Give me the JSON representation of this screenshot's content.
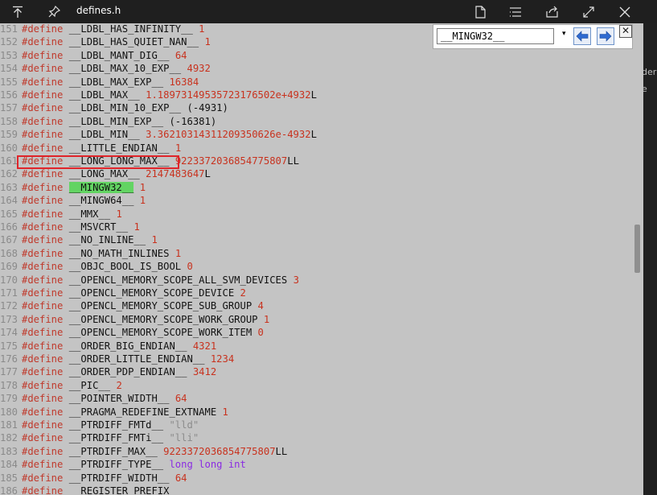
{
  "window": {
    "title": "defines.h",
    "icons": [
      "go-to-top-icon",
      "pin-icon",
      "new-file-icon",
      "list-icon",
      "share-icon",
      "expand-icon",
      "close-icon"
    ]
  },
  "find": {
    "value": "__MINGW32__",
    "dropdown": "▾",
    "prev_label": "previous",
    "next_label": "next",
    "close": "✕"
  },
  "right_strip": [
    "der",
    "e"
  ],
  "code": {
    "lines": [
      {
        "n": "151",
        "name": "__LDBL_HAS_INFINITY__",
        "value": "1"
      },
      {
        "n": "152",
        "name": "__LDBL_HAS_QUIET_NAN__",
        "value": "1"
      },
      {
        "n": "153",
        "name": "__LDBL_MANT_DIG__",
        "value": "64"
      },
      {
        "n": "154",
        "name": "__LDBL_MAX_10_EXP__",
        "value": "4932"
      },
      {
        "n": "155",
        "name": "__LDBL_MAX_EXP__",
        "value": "16384"
      },
      {
        "n": "156",
        "name": "__LDBL_MAX__",
        "value": "1.18973149535723176502e+4932",
        "suffix": "L"
      },
      {
        "n": "157",
        "name": "__LDBL_MIN_10_EXP__",
        "plain": "(-4931)"
      },
      {
        "n": "158",
        "name": "__LDBL_MIN_EXP__",
        "plain": "(-16381)"
      },
      {
        "n": "159",
        "name": "__LDBL_MIN__",
        "value": "3.36210314311209350626e-4932",
        "suffix": "L"
      },
      {
        "n": "160",
        "name": "__LITTLE_ENDIAN__",
        "value": "1"
      },
      {
        "n": "161",
        "name": "__LONG_LONG_MAX__",
        "value": "9223372036854775807",
        "suffix": "LL"
      },
      {
        "n": "162",
        "name": "__LONG_MAX__",
        "value": "2147483647",
        "suffix": "L"
      },
      {
        "n": "163",
        "name": "__MINGW32__",
        "value": "1",
        "highlight": true
      },
      {
        "n": "164",
        "name": "__MINGW64__",
        "value": "1"
      },
      {
        "n": "165",
        "name": "__MMX__",
        "value": "1"
      },
      {
        "n": "166",
        "name": "__MSVCRT__",
        "value": "1"
      },
      {
        "n": "167",
        "name": "__NO_INLINE__",
        "value": "1"
      },
      {
        "n": "168",
        "name": "__NO_MATH_INLINES",
        "value": "1"
      },
      {
        "n": "169",
        "name": "__OBJC_BOOL_IS_BOOL",
        "value": "0"
      },
      {
        "n": "170",
        "name": "__OPENCL_MEMORY_SCOPE_ALL_SVM_DEVICES",
        "value": "3"
      },
      {
        "n": "171",
        "name": "__OPENCL_MEMORY_SCOPE_DEVICE",
        "value": "2"
      },
      {
        "n": "172",
        "name": "__OPENCL_MEMORY_SCOPE_SUB_GROUP",
        "value": "4"
      },
      {
        "n": "173",
        "name": "__OPENCL_MEMORY_SCOPE_WORK_GROUP",
        "value": "1"
      },
      {
        "n": "174",
        "name": "__OPENCL_MEMORY_SCOPE_WORK_ITEM",
        "value": "0"
      },
      {
        "n": "175",
        "name": "__ORDER_BIG_ENDIAN__",
        "value": "4321"
      },
      {
        "n": "176",
        "name": "__ORDER_LITTLE_ENDIAN__",
        "value": "1234"
      },
      {
        "n": "177",
        "name": "__ORDER_PDP_ENDIAN__",
        "value": "3412"
      },
      {
        "n": "178",
        "name": "__PIC__",
        "value": "2"
      },
      {
        "n": "179",
        "name": "__POINTER_WIDTH__",
        "value": "64"
      },
      {
        "n": "180",
        "name": "__PRAGMA_REDEFINE_EXTNAME",
        "value": "1"
      },
      {
        "n": "181",
        "name": "__PTRDIFF_FMTd__",
        "str": "\"lld\""
      },
      {
        "n": "182",
        "name": "__PTRDIFF_FMTi__",
        "str": "\"lli\""
      },
      {
        "n": "183",
        "name": "__PTRDIFF_MAX__",
        "value": "9223372036854775807",
        "suffix": "LL"
      },
      {
        "n": "184",
        "name": "__PTRDIFF_TYPE__",
        "type": "long long int"
      },
      {
        "n": "185",
        "name": "__PTRDIFF_WIDTH__",
        "value": "64"
      },
      {
        "n": "186",
        "name": "__REGISTER_PREFIX__"
      }
    ],
    "keyword": "#define"
  },
  "colors": {
    "editor_bg": "#c4c4c4",
    "keyword": "#c0392b",
    "value": "#c8321e",
    "highlight": "#63d463",
    "annotation_box": "#e0242a"
  }
}
